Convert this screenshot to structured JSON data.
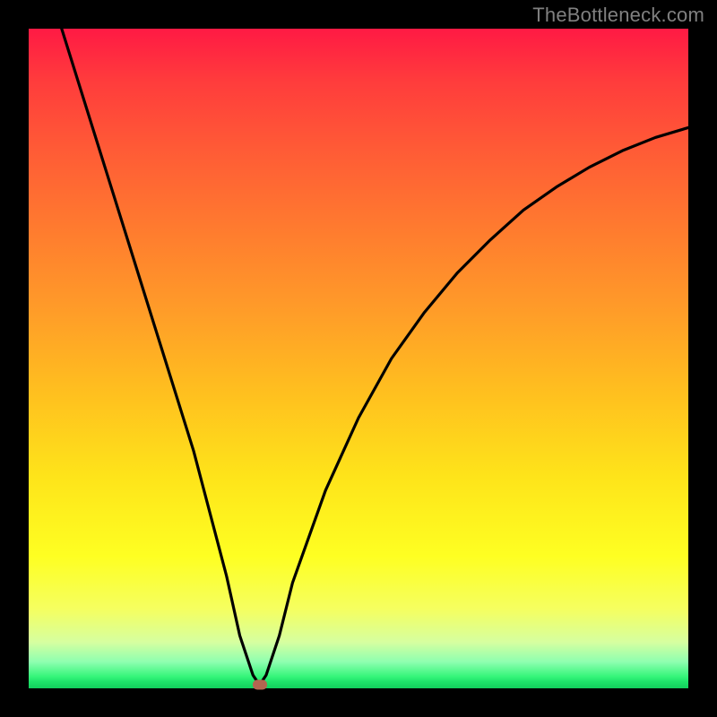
{
  "watermark": "TheBottleneck.com",
  "chart_data": {
    "type": "line",
    "title": "",
    "xlabel": "",
    "ylabel": "",
    "xlim": [
      0,
      100
    ],
    "ylim": [
      0,
      100
    ],
    "series": [
      {
        "name": "curve",
        "x": [
          5,
          10,
          15,
          20,
          25,
          30,
          32,
          34,
          35,
          36,
          38,
          40,
          45,
          50,
          55,
          60,
          65,
          70,
          75,
          80,
          85,
          90,
          95,
          100
        ],
        "y": [
          100,
          84,
          68,
          52,
          36,
          17,
          8,
          2,
          0.5,
          2,
          8,
          16,
          30,
          41,
          50,
          57,
          63,
          68,
          72.5,
          76,
          79,
          81.5,
          83.5,
          85
        ]
      }
    ],
    "marker": {
      "x": 35,
      "y": 0.6
    },
    "gradient_stops": [
      {
        "pos": 0.0,
        "color": "#ff1a44"
      },
      {
        "pos": 0.4,
        "color": "#ff9425"
      },
      {
        "pos": 0.78,
        "color": "#fef31e"
      },
      {
        "pos": 0.985,
        "color": "#28e770"
      },
      {
        "pos": 1.0,
        "color": "#12cf5c"
      }
    ]
  }
}
